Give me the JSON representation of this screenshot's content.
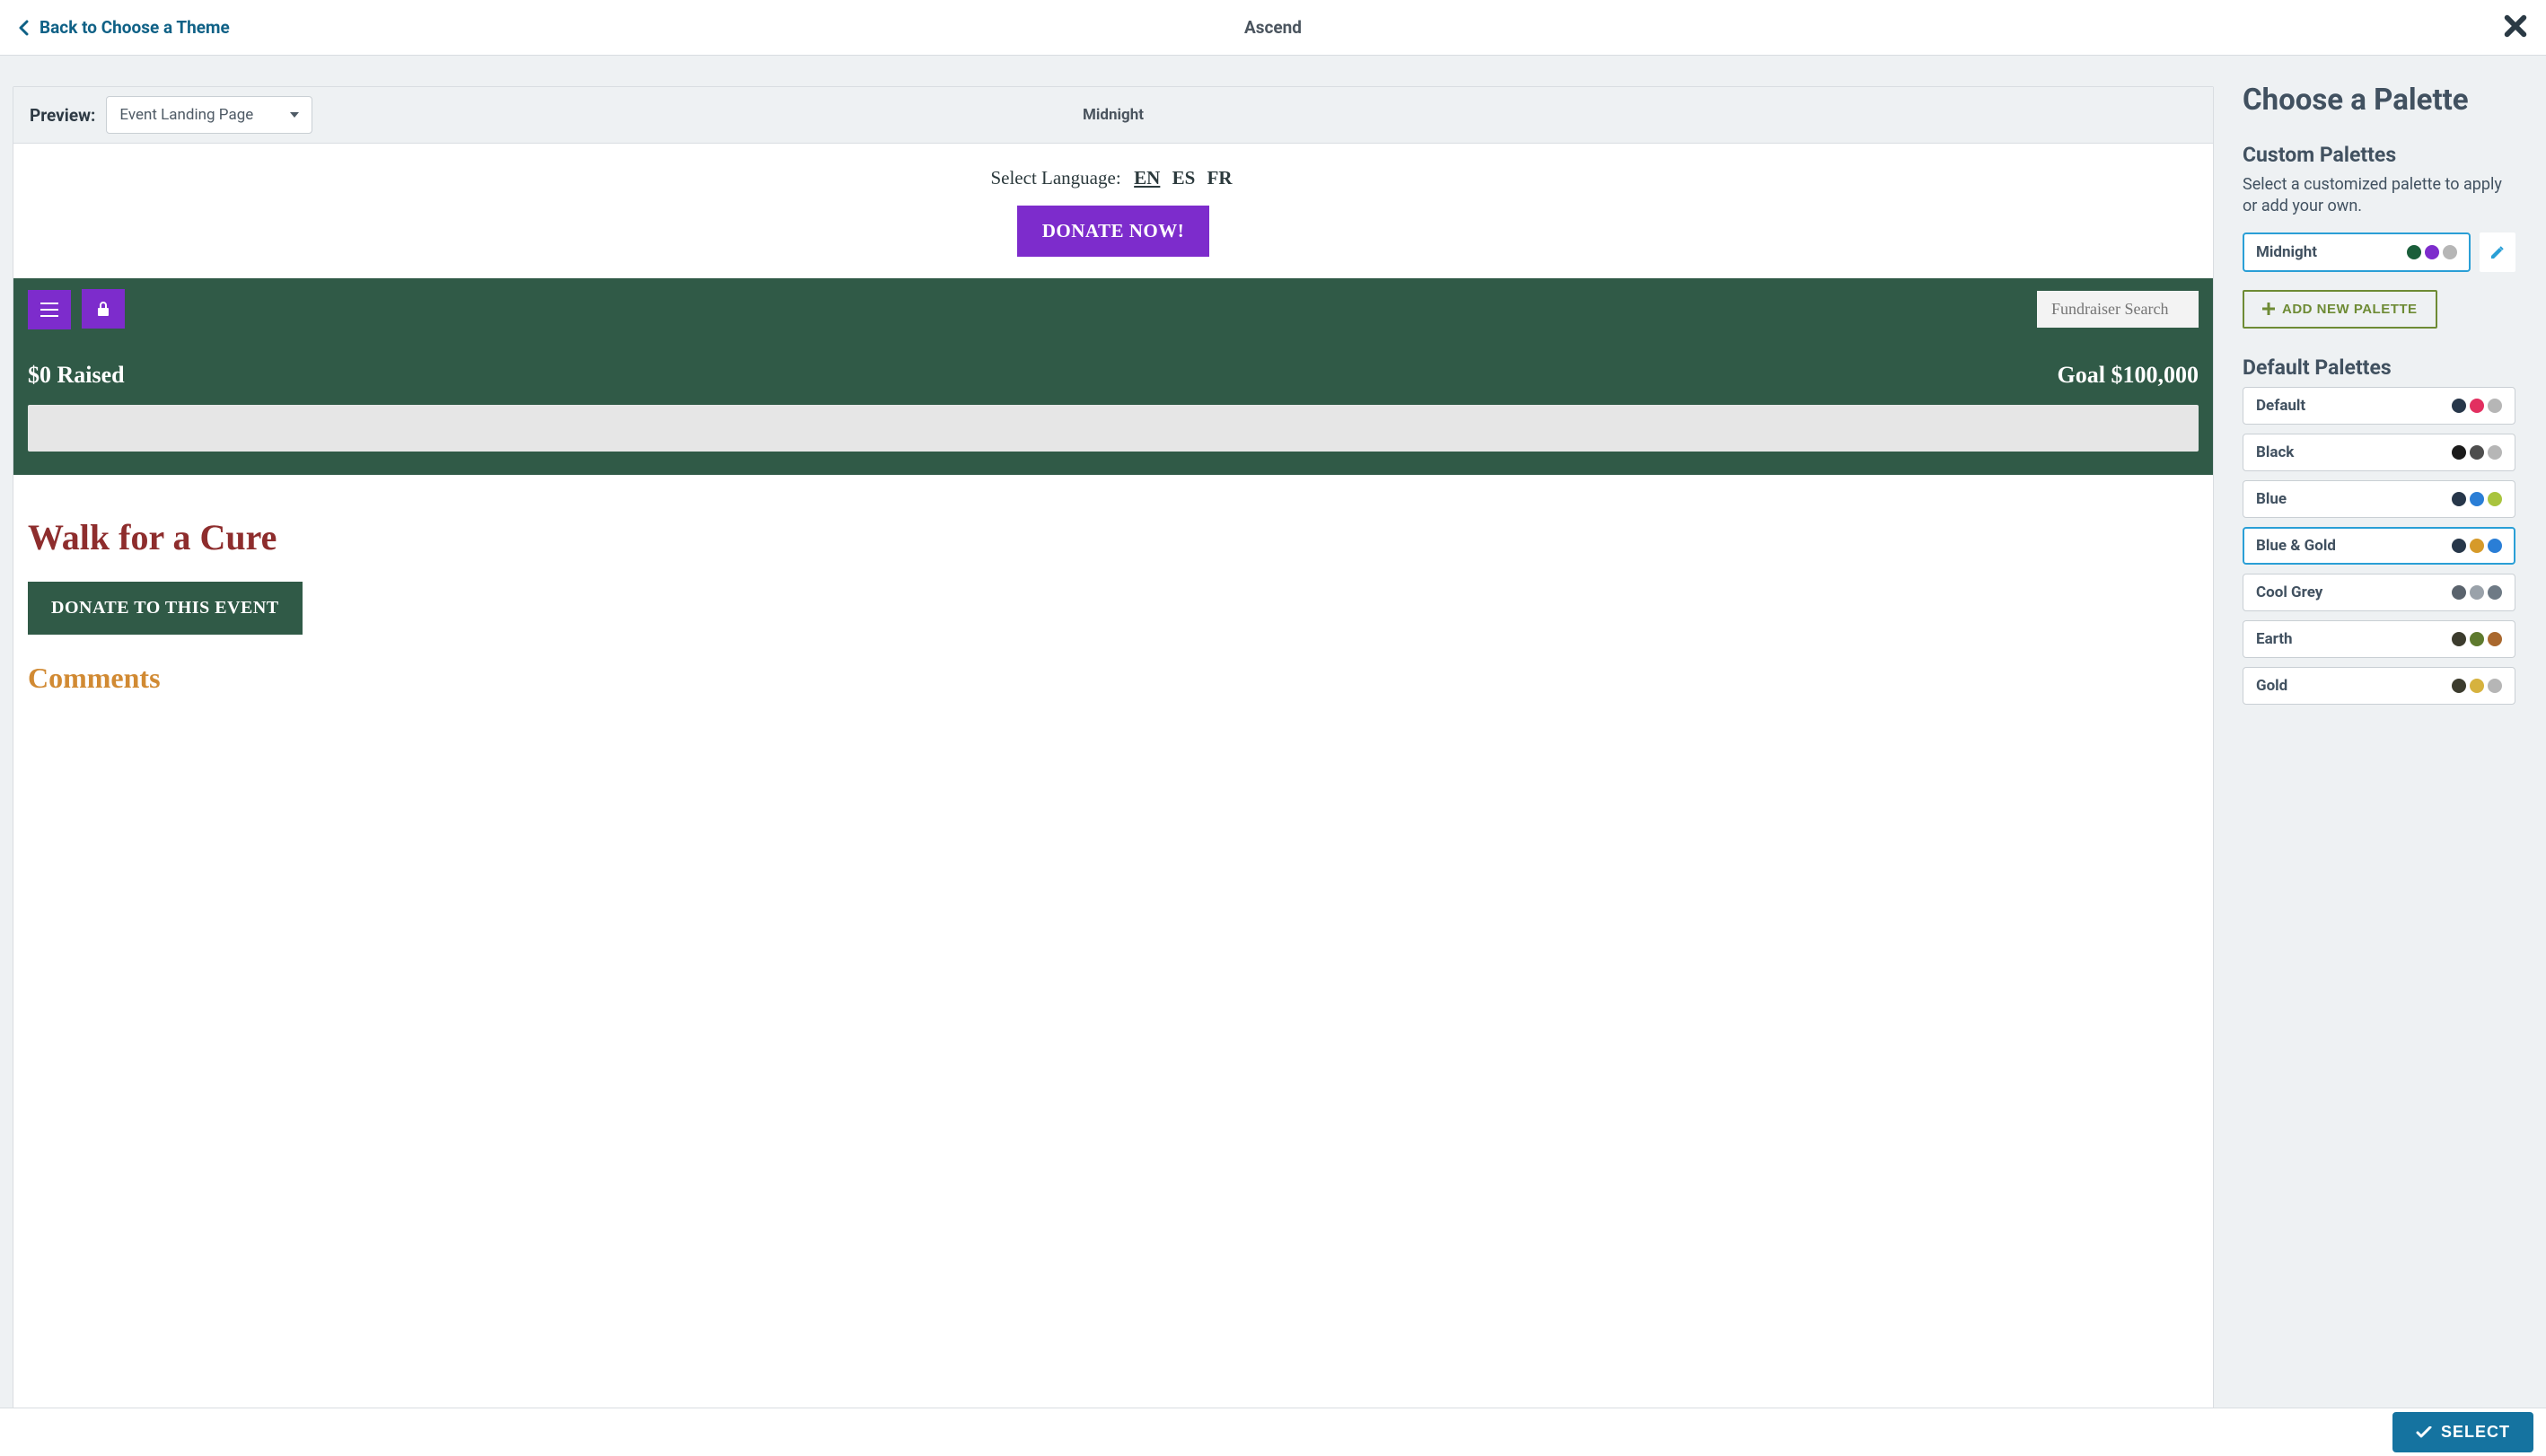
{
  "header": {
    "back_label": "Back to Choose a Theme",
    "theme_name": "Ascend"
  },
  "preview": {
    "label": "Preview:",
    "selected": "Event Landing Page",
    "palette_name": "Midnight",
    "lang_label": "Select Language:",
    "lang_en": "EN",
    "lang_es": "ES",
    "lang_fr": "FR",
    "donate_now": "DONATE NOW!",
    "search_placeholder": "Fundraiser Search",
    "raised": "$0 Raised",
    "goal": "Goal $100,000",
    "event_title": "Walk for a Cure",
    "donate_event": "DONATE TO THIS EVENT",
    "comments": "Comments"
  },
  "palettes": {
    "heading": "Choose a Palette",
    "custom_heading": "Custom Palettes",
    "custom_desc": "Select a customized palette to apply or add your own.",
    "add_label": "ADD NEW PALETTE",
    "default_heading": "Default Palettes",
    "custom_items": [
      {
        "name": "Midnight",
        "colors": [
          "#1a5e3a",
          "#7d2ccc",
          "#b6b6b6"
        ],
        "active": true
      }
    ],
    "default_items": [
      {
        "name": "Default",
        "colors": [
          "#27374a",
          "#e22f60",
          "#b6b6b6"
        ]
      },
      {
        "name": "Black",
        "colors": [
          "#1b1b1b",
          "#4e4e4e",
          "#b6b6b6"
        ]
      },
      {
        "name": "Blue",
        "colors": [
          "#27374a",
          "#2a7ed6",
          "#a9c43e"
        ]
      },
      {
        "name": "Blue & Gold",
        "colors": [
          "#27374a",
          "#d69a2a",
          "#2a7ed6"
        ],
        "highlight": true
      },
      {
        "name": "Cool Grey",
        "colors": [
          "#5a636d",
          "#9aa2aa",
          "#6e7a85"
        ]
      },
      {
        "name": "Earth",
        "colors": [
          "#3c3c2e",
          "#5e7a2e",
          "#a9682e"
        ]
      },
      {
        "name": "Gold",
        "colors": [
          "#3c3c2e",
          "#d6b23e",
          "#b6b6b6"
        ]
      }
    ]
  },
  "footer": {
    "select_label": "SELECT"
  }
}
